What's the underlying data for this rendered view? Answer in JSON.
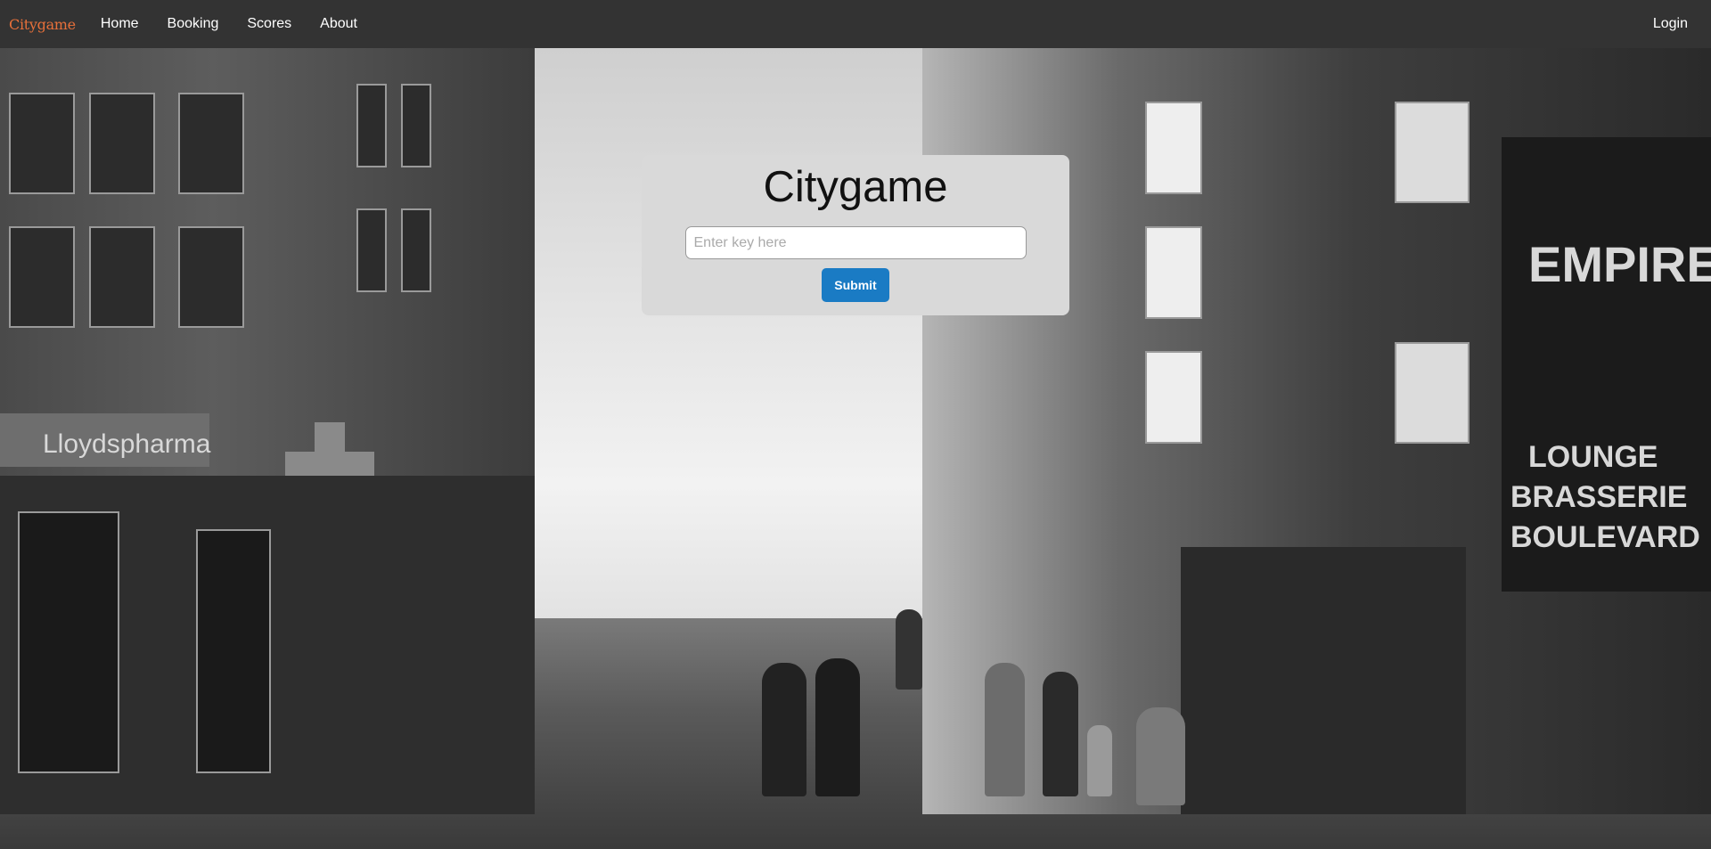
{
  "nav": {
    "brand": "Citygame",
    "links": [
      "Home",
      "Booking",
      "Scores",
      "About"
    ],
    "login": "Login"
  },
  "card": {
    "title": "Citygame",
    "input_placeholder": "Enter key here",
    "submit_label": "Submit"
  },
  "background": {
    "signs": [
      "Lloydspharma",
      "EMPIRE",
      "LOUNGE",
      "BRASSERIE",
      "BOULEVARD"
    ]
  },
  "colors": {
    "navbar": "#333333",
    "brand": "#e8703a",
    "card": "#d9d9d9",
    "submit": "#1a7bc4"
  }
}
